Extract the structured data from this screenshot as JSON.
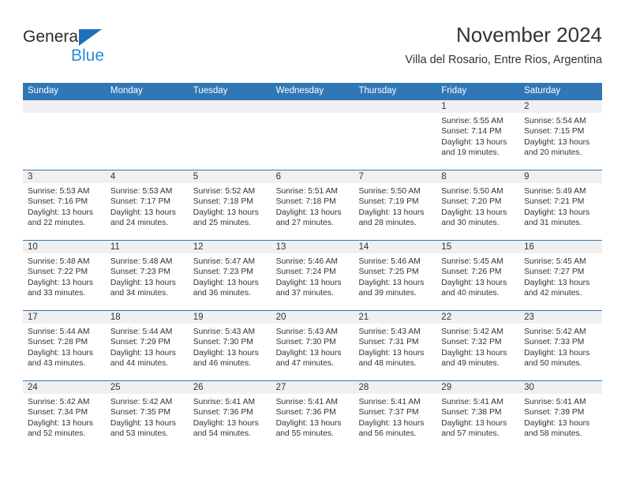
{
  "brand": {
    "name_top": "General",
    "name_bottom": "Blue",
    "triangle_color": "#1c6fba",
    "blue_text_color": "#2a8fd4"
  },
  "header": {
    "title": "November 2024",
    "subtitle": "Villa del Rosario, Entre Rios, Argentina"
  },
  "colors": {
    "header_band": "#3077b6",
    "daynum_band": "#f0f0f0",
    "text": "#333333"
  },
  "weekday_headers": [
    "Sunday",
    "Monday",
    "Tuesday",
    "Wednesday",
    "Thursday",
    "Friday",
    "Saturday"
  ],
  "weeks": [
    [
      {
        "day": "",
        "sunrise": "",
        "sunset": "",
        "daylight_1": "",
        "daylight_2": ""
      },
      {
        "day": "",
        "sunrise": "",
        "sunset": "",
        "daylight_1": "",
        "daylight_2": ""
      },
      {
        "day": "",
        "sunrise": "",
        "sunset": "",
        "daylight_1": "",
        "daylight_2": ""
      },
      {
        "day": "",
        "sunrise": "",
        "sunset": "",
        "daylight_1": "",
        "daylight_2": ""
      },
      {
        "day": "",
        "sunrise": "",
        "sunset": "",
        "daylight_1": "",
        "daylight_2": ""
      },
      {
        "day": "1",
        "sunrise": "Sunrise: 5:55 AM",
        "sunset": "Sunset: 7:14 PM",
        "daylight_1": "Daylight: 13 hours",
        "daylight_2": "and 19 minutes."
      },
      {
        "day": "2",
        "sunrise": "Sunrise: 5:54 AM",
        "sunset": "Sunset: 7:15 PM",
        "daylight_1": "Daylight: 13 hours",
        "daylight_2": "and 20 minutes."
      }
    ],
    [
      {
        "day": "3",
        "sunrise": "Sunrise: 5:53 AM",
        "sunset": "Sunset: 7:16 PM",
        "daylight_1": "Daylight: 13 hours",
        "daylight_2": "and 22 minutes."
      },
      {
        "day": "4",
        "sunrise": "Sunrise: 5:53 AM",
        "sunset": "Sunset: 7:17 PM",
        "daylight_1": "Daylight: 13 hours",
        "daylight_2": "and 24 minutes."
      },
      {
        "day": "5",
        "sunrise": "Sunrise: 5:52 AM",
        "sunset": "Sunset: 7:18 PM",
        "daylight_1": "Daylight: 13 hours",
        "daylight_2": "and 25 minutes."
      },
      {
        "day": "6",
        "sunrise": "Sunrise: 5:51 AM",
        "sunset": "Sunset: 7:18 PM",
        "daylight_1": "Daylight: 13 hours",
        "daylight_2": "and 27 minutes."
      },
      {
        "day": "7",
        "sunrise": "Sunrise: 5:50 AM",
        "sunset": "Sunset: 7:19 PM",
        "daylight_1": "Daylight: 13 hours",
        "daylight_2": "and 28 minutes."
      },
      {
        "day": "8",
        "sunrise": "Sunrise: 5:50 AM",
        "sunset": "Sunset: 7:20 PM",
        "daylight_1": "Daylight: 13 hours",
        "daylight_2": "and 30 minutes."
      },
      {
        "day": "9",
        "sunrise": "Sunrise: 5:49 AM",
        "sunset": "Sunset: 7:21 PM",
        "daylight_1": "Daylight: 13 hours",
        "daylight_2": "and 31 minutes."
      }
    ],
    [
      {
        "day": "10",
        "sunrise": "Sunrise: 5:48 AM",
        "sunset": "Sunset: 7:22 PM",
        "daylight_1": "Daylight: 13 hours",
        "daylight_2": "and 33 minutes."
      },
      {
        "day": "11",
        "sunrise": "Sunrise: 5:48 AM",
        "sunset": "Sunset: 7:23 PM",
        "daylight_1": "Daylight: 13 hours",
        "daylight_2": "and 34 minutes."
      },
      {
        "day": "12",
        "sunrise": "Sunrise: 5:47 AM",
        "sunset": "Sunset: 7:23 PM",
        "daylight_1": "Daylight: 13 hours",
        "daylight_2": "and 36 minutes."
      },
      {
        "day": "13",
        "sunrise": "Sunrise: 5:46 AM",
        "sunset": "Sunset: 7:24 PM",
        "daylight_1": "Daylight: 13 hours",
        "daylight_2": "and 37 minutes."
      },
      {
        "day": "14",
        "sunrise": "Sunrise: 5:46 AM",
        "sunset": "Sunset: 7:25 PM",
        "daylight_1": "Daylight: 13 hours",
        "daylight_2": "and 39 minutes."
      },
      {
        "day": "15",
        "sunrise": "Sunrise: 5:45 AM",
        "sunset": "Sunset: 7:26 PM",
        "daylight_1": "Daylight: 13 hours",
        "daylight_2": "and 40 minutes."
      },
      {
        "day": "16",
        "sunrise": "Sunrise: 5:45 AM",
        "sunset": "Sunset: 7:27 PM",
        "daylight_1": "Daylight: 13 hours",
        "daylight_2": "and 42 minutes."
      }
    ],
    [
      {
        "day": "17",
        "sunrise": "Sunrise: 5:44 AM",
        "sunset": "Sunset: 7:28 PM",
        "daylight_1": "Daylight: 13 hours",
        "daylight_2": "and 43 minutes."
      },
      {
        "day": "18",
        "sunrise": "Sunrise: 5:44 AM",
        "sunset": "Sunset: 7:29 PM",
        "daylight_1": "Daylight: 13 hours",
        "daylight_2": "and 44 minutes."
      },
      {
        "day": "19",
        "sunrise": "Sunrise: 5:43 AM",
        "sunset": "Sunset: 7:30 PM",
        "daylight_1": "Daylight: 13 hours",
        "daylight_2": "and 46 minutes."
      },
      {
        "day": "20",
        "sunrise": "Sunrise: 5:43 AM",
        "sunset": "Sunset: 7:30 PM",
        "daylight_1": "Daylight: 13 hours",
        "daylight_2": "and 47 minutes."
      },
      {
        "day": "21",
        "sunrise": "Sunrise: 5:43 AM",
        "sunset": "Sunset: 7:31 PM",
        "daylight_1": "Daylight: 13 hours",
        "daylight_2": "and 48 minutes."
      },
      {
        "day": "22",
        "sunrise": "Sunrise: 5:42 AM",
        "sunset": "Sunset: 7:32 PM",
        "daylight_1": "Daylight: 13 hours",
        "daylight_2": "and 49 minutes."
      },
      {
        "day": "23",
        "sunrise": "Sunrise: 5:42 AM",
        "sunset": "Sunset: 7:33 PM",
        "daylight_1": "Daylight: 13 hours",
        "daylight_2": "and 50 minutes."
      }
    ],
    [
      {
        "day": "24",
        "sunrise": "Sunrise: 5:42 AM",
        "sunset": "Sunset: 7:34 PM",
        "daylight_1": "Daylight: 13 hours",
        "daylight_2": "and 52 minutes."
      },
      {
        "day": "25",
        "sunrise": "Sunrise: 5:42 AM",
        "sunset": "Sunset: 7:35 PM",
        "daylight_1": "Daylight: 13 hours",
        "daylight_2": "and 53 minutes."
      },
      {
        "day": "26",
        "sunrise": "Sunrise: 5:41 AM",
        "sunset": "Sunset: 7:36 PM",
        "daylight_1": "Daylight: 13 hours",
        "daylight_2": "and 54 minutes."
      },
      {
        "day": "27",
        "sunrise": "Sunrise: 5:41 AM",
        "sunset": "Sunset: 7:36 PM",
        "daylight_1": "Daylight: 13 hours",
        "daylight_2": "and 55 minutes."
      },
      {
        "day": "28",
        "sunrise": "Sunrise: 5:41 AM",
        "sunset": "Sunset: 7:37 PM",
        "daylight_1": "Daylight: 13 hours",
        "daylight_2": "and 56 minutes."
      },
      {
        "day": "29",
        "sunrise": "Sunrise: 5:41 AM",
        "sunset": "Sunset: 7:38 PM",
        "daylight_1": "Daylight: 13 hours",
        "daylight_2": "and 57 minutes."
      },
      {
        "day": "30",
        "sunrise": "Sunrise: 5:41 AM",
        "sunset": "Sunset: 7:39 PM",
        "daylight_1": "Daylight: 13 hours",
        "daylight_2": "and 58 minutes."
      }
    ]
  ]
}
